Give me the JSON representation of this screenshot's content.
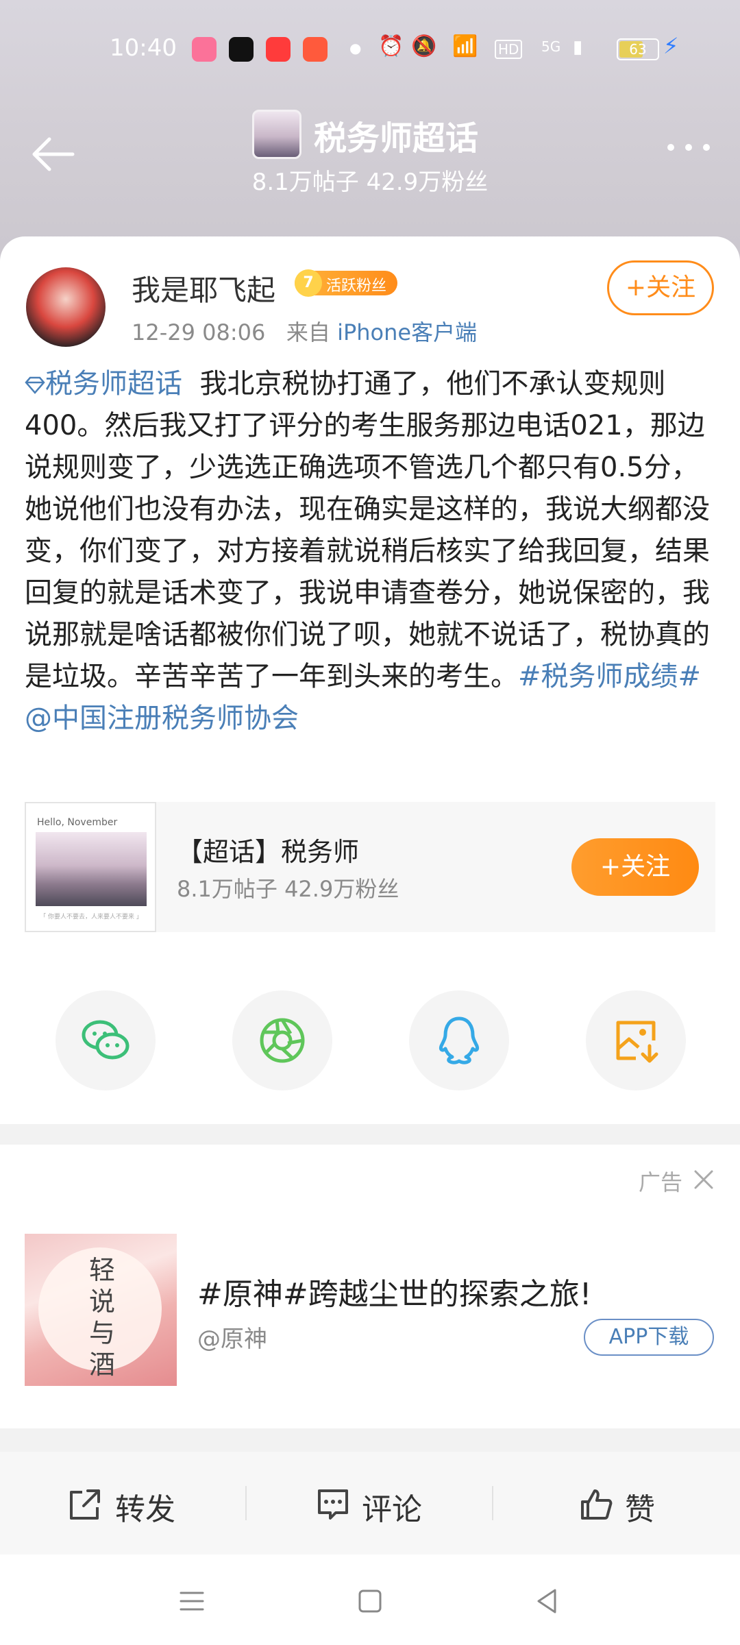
{
  "status_bar": {
    "time": "10:40",
    "battery": "63",
    "battery_level": 0.63,
    "network": "5G",
    "hd": "HD",
    "app_icons": [
      "bilibili-icon",
      "capcut-icon",
      "video-icon",
      "app-icon"
    ],
    "colors": {
      "bilibili": "#fb7299",
      "capcut": "#111111",
      "video": "#ff3b3b",
      "app": "#ff5a3c"
    }
  },
  "header": {
    "title": "税务师超话",
    "stats": "8.1万帖子  42.9万粉丝"
  },
  "post": {
    "author": "我是耶飞起",
    "fan_level": "7",
    "fan_badge": "活跃粉丝",
    "time": "12-29 08:06",
    "source_prefix": "来自",
    "source": "iPhone客户端",
    "follow_label": "+关注",
    "topic_link": "税务师超话",
    "body": "我北京税协打通了，他们不承认变规则400。然后我又打了评分的考生服务那边电话021，那边说规则变了，少选选正确选项不管选几个都只有0.5分，她说他们也没有办法，现在确实是这样的，我说大纲都没变，你们变了，对方接着就说稍后核实了给我回复，结果回复的就是话术变了，我说申请查卷分，她说保密的，我说那就是啥话都被你们说了呗，她就不说话了，税协真的是垃圾。辛苦辛苦了一年到头来的考生。",
    "hashtag": "#税务师成绩#",
    "mention": "@中国注册税务师协会"
  },
  "topic_card": {
    "thumb_text": "Hello, November",
    "thumb_caption": "「 你要人不要去，人来要人不要来 」",
    "name": "【超话】税务师",
    "stats": "8.1万帖子 42.9万粉丝",
    "follow_label": "+关注"
  },
  "share": {
    "icons": [
      "wechat-icon",
      "moments-icon",
      "qq-icon",
      "save-image-icon"
    ],
    "colors": {
      "wechat": "#3cbf78",
      "moments": "#5fc65a",
      "qq": "#35a9e6",
      "save": "#f4a21b"
    }
  },
  "ad": {
    "label": "广告",
    "image_text": "轻说与酒",
    "title": "#原神#跨越尘世的探索之旅!",
    "account": "@原神",
    "download_label": "APP下载"
  },
  "actions": {
    "repost": "转发",
    "comment": "评论",
    "like": "赞"
  },
  "colors": {
    "accent_orange": "#ff8c1a",
    "link_blue": "#4a7fb7"
  }
}
